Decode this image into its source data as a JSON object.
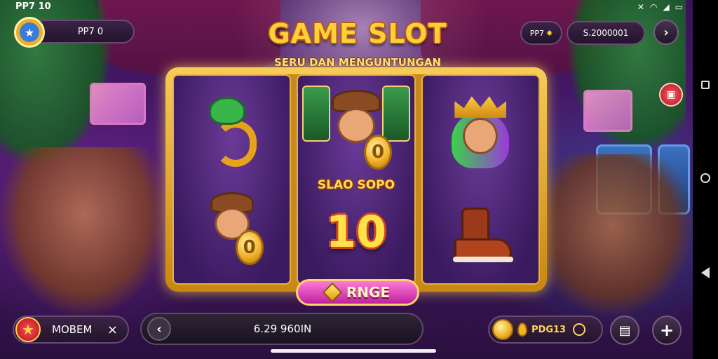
{
  "status_bar": {
    "clock": "PP7 10",
    "icons": [
      "mute-icon",
      "wifi-icon",
      "signal-icon",
      "battery-icon"
    ]
  },
  "top_hud": {
    "player_label": "PP7 0",
    "level_label": "PP7",
    "balance": "S.2000001",
    "next_label": "›"
  },
  "title": {
    "main": "GAME SLOT",
    "sub": "SERU DAN MENGUNTUNGAN"
  },
  "reels": {
    "middle_caption": "SLAO SOPO",
    "big_number": "10",
    "symbols": [
      "dragon",
      "explorer",
      "queen",
      "explorer-coin",
      "number-10",
      "boot"
    ]
  },
  "spin_button": {
    "label": "RNGE"
  },
  "bottom_hud": {
    "left_label": "MOBEM",
    "left_close": "×",
    "back_label": "‹",
    "amount": "6.29 960IN",
    "coins_label": "PDG13",
    "add_label": "+"
  },
  "colors": {
    "accent_gold": "#ffcf3a",
    "spin_pink": "#c0209e",
    "frame_gold": "#f7cc57"
  }
}
